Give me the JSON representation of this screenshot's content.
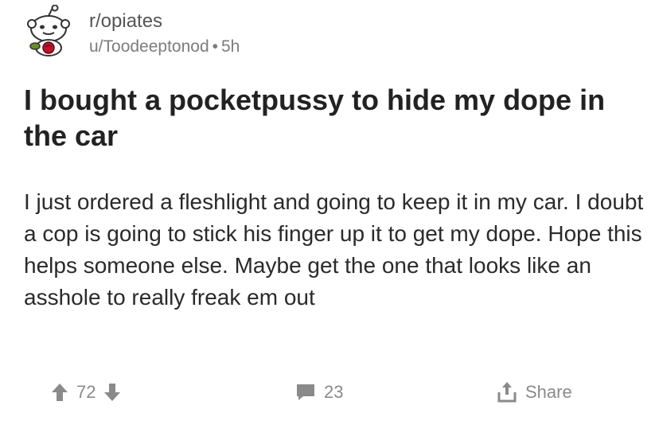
{
  "post": {
    "subreddit": "r/opiates",
    "author": "u/Toodeeptonod",
    "separator": "•",
    "age": "5h",
    "avatar_icon": "subreddit-snoo-avatar-icon",
    "title": "I bought a pocketpussy to hide my dope in the car",
    "body": "I just ordered a fleshlight and going to keep it in my car. I doubt a cop is going to stick his finger up it to get my dope. Hope this helps someone else. Maybe get the one that looks like an asshole to really freak em out"
  },
  "actions": {
    "score": "72",
    "comments": "23",
    "share_label": "Share",
    "upvote_icon": "upvote-arrow-icon",
    "downvote_icon": "downvote-arrow-icon",
    "comment_icon": "comment-bubble-icon",
    "share_icon": "share-icon"
  },
  "colors": {
    "text": "#222222",
    "meta": "#7c7c7c",
    "icon": "#8a8a8a"
  }
}
